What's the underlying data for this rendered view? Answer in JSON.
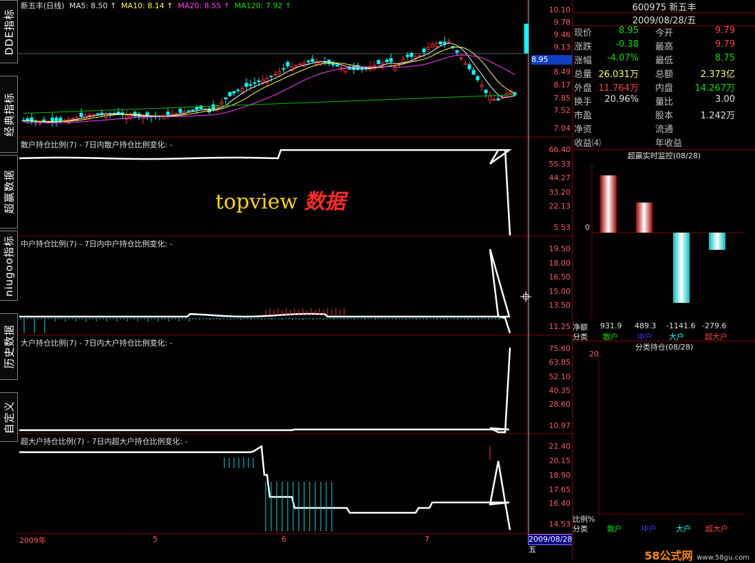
{
  "tabs": [
    "DDE指标",
    "经典指标",
    "超赢数据",
    "niugoo指标",
    "历史数据",
    "自定义"
  ],
  "main_header": {
    "name": "新五丰(日线)",
    "ma5_label": "MA5:",
    "ma5": "8.50 ↑",
    "ma10_label": "MA10:",
    "ma10": "8.14 ↑",
    "ma20_label": "MA20:",
    "ma20": "8.55 ↑",
    "ma120_label": "MA120:",
    "ma120": "7.92 ↑"
  },
  "main_scale": [
    "10.10",
    "9.78",
    "9.46",
    "9.13",
    "8.81",
    "8.49",
    "8.17",
    "7.85",
    "7.52",
    "7.04"
  ],
  "current_price_tag": "8.95",
  "panels": [
    {
      "header": "散户持仓比例(7)  -    7日内散户持仓比例变化:  -",
      "scale": [
        "66.40",
        "55.33",
        "44.27",
        "33.20",
        "22.13",
        "5.53"
      ]
    },
    {
      "header": "中户持仓比例(7)  -    7日内中户持仓比例变化:  -",
      "scale": [
        "19.50",
        "18.00",
        "16.50",
        "15.00",
        "13.50",
        "11.25"
      ]
    },
    {
      "header": "大户持仓比例(7)  -    7日内大户持仓比例变化:  -",
      "scale": [
        "75.60",
        "63.85",
        "52.10",
        "40.35",
        "28.60",
        "10.97"
      ]
    },
    {
      "header": "超大户持仓比例(7)  -    7日内超大户持仓比例变化:  -",
      "scale": [
        "21.40",
        "20.15",
        "18.90",
        "17.65",
        "16.40",
        "14.53"
      ]
    }
  ],
  "watermark": {
    "a": "topview",
    "b": "数据"
  },
  "bottom_axis": [
    "2009年",
    "5",
    "6",
    "7"
  ],
  "cursor_date": "2009/08/28/五",
  "quote": {
    "code_name": "600975 新五丰",
    "date": "2009/08/28/五",
    "rows": [
      {
        "k": "现价",
        "v": "8.95",
        "vc": "green",
        "k2": "今开",
        "v2": "9.79",
        "v2c": "red"
      },
      {
        "k": "涨跌",
        "v": "-0.38",
        "vc": "green",
        "k2": "最高",
        "v2": "9.79",
        "v2c": "red"
      },
      {
        "k": "涨幅",
        "v": "-4.07%",
        "vc": "green",
        "k2": "最低",
        "v2": "8.75",
        "v2c": "green"
      },
      {
        "k": "总量",
        "v": "26.031万",
        "vc": "yellow",
        "k2": "总额",
        "v2": "2.373亿",
        "v2c": "yellow"
      },
      {
        "k": "外盘",
        "v": "11.764万",
        "vc": "red",
        "k2": "内盘",
        "v2": "14.267万",
        "v2c": "green"
      },
      {
        "k": "换手",
        "v": "20.96%",
        "vc": "white",
        "k2": "量比",
        "v2": "3.00",
        "v2c": "white"
      },
      {
        "k": "市盈",
        "v": "",
        "vc": "white",
        "k2": "股本",
        "v2": "1.242万",
        "v2c": "white"
      },
      {
        "k": "净资",
        "v": "",
        "vc": "white",
        "k2": "流通",
        "v2": "",
        "v2c": "white"
      },
      {
        "k": "收益⑷",
        "v": "",
        "vc": "white",
        "k2": "年收益",
        "v2": "",
        "v2c": "white"
      }
    ]
  },
  "monitor": {
    "title": "超赢实时监控(08/28)",
    "zero_label": "0",
    "net_label": "净额",
    "class_label": "分类",
    "values": [
      "931.9",
      "489.3",
      "-1141.6",
      "-279.6"
    ],
    "categories": [
      "散户",
      "中户",
      "大户",
      "超大户"
    ],
    "category_colors": [
      "#00e000",
      "#4040ff",
      "#00ffff",
      "#ff4040"
    ]
  },
  "holding": {
    "title": "分类持仓(08/28)",
    "ymax_label": "20",
    "pct_label": "比例%",
    "class_label": "分类",
    "categories": [
      "散户",
      "中户",
      "大户",
      "超大户"
    ]
  },
  "site_logo": {
    "main": "58公式网",
    "sub": "www.58gu.com"
  }
}
